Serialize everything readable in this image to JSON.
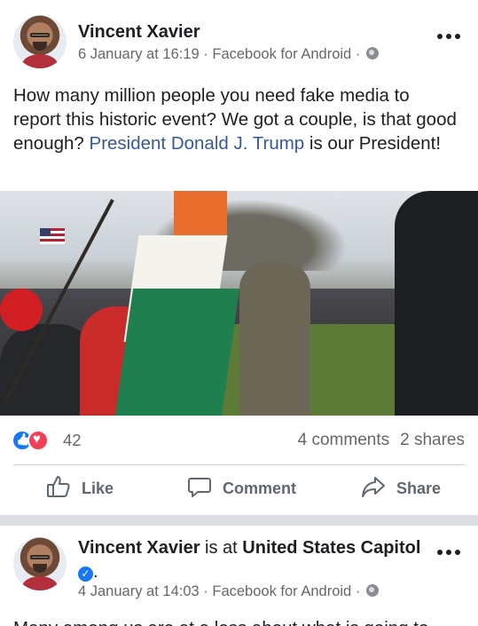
{
  "post1": {
    "author": "Vincent Xavier",
    "timestamp": "6 January at 16:19",
    "source": "Facebook for Android",
    "separator": "·",
    "text_before_link": "How many million people you need fake media to report this historic event? We got a couple, is that good enough? ",
    "link_text": "President Donald J. Trump",
    "text_after_link": " is our President!",
    "reaction_count": "42",
    "comments": "4 comments",
    "shares": "2 shares",
    "actions": {
      "like": "Like",
      "comment": "Comment",
      "share": "Share"
    }
  },
  "post2": {
    "author": "Vincent Xavier",
    "is_at": " is at ",
    "place": "United States Capitol",
    "after_check": ".",
    "timestamp": "4 January at 14:03",
    "source": "Facebook for Android",
    "separator": "·",
    "text": "Many among us are at a loss about what is going to"
  },
  "icons": {
    "more": "more-options-icon",
    "privacy": "globe-icon",
    "like": "thumbs-up-icon",
    "comment": "comment-bubble-icon",
    "share": "share-arrow-icon",
    "verified": "verified-check-icon"
  },
  "colors": {
    "link": "#385898",
    "meta": "#65676b",
    "like_blue": "#1877f2",
    "love_red": "#f33e58",
    "action_gray": "#606770"
  }
}
